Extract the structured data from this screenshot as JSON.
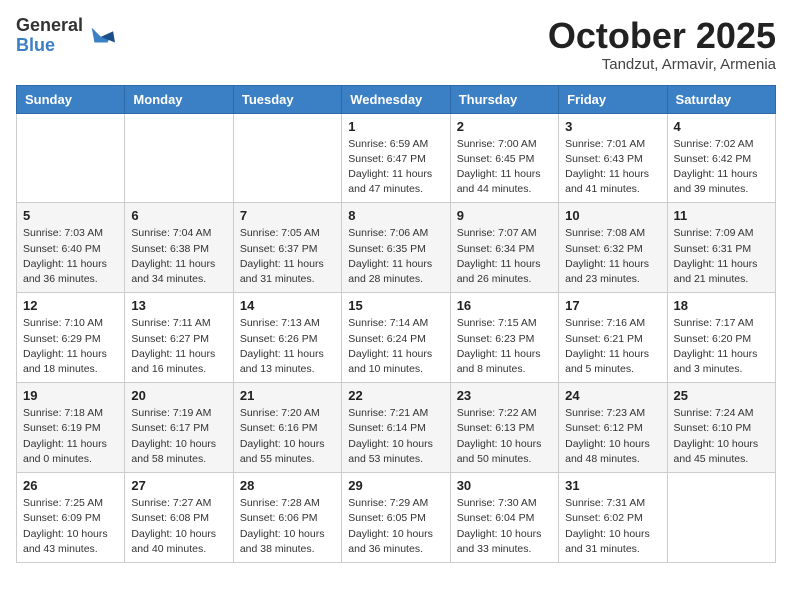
{
  "logo": {
    "general": "General",
    "blue": "Blue"
  },
  "title": "October 2025",
  "subtitle": "Tandzut, Armavir, Armenia",
  "days_of_week": [
    "Sunday",
    "Monday",
    "Tuesday",
    "Wednesday",
    "Thursday",
    "Friday",
    "Saturday"
  ],
  "weeks": [
    [
      {
        "day": "",
        "info": ""
      },
      {
        "day": "",
        "info": ""
      },
      {
        "day": "",
        "info": ""
      },
      {
        "day": "1",
        "info": "Sunrise: 6:59 AM\nSunset: 6:47 PM\nDaylight: 11 hours\nand 47 minutes."
      },
      {
        "day": "2",
        "info": "Sunrise: 7:00 AM\nSunset: 6:45 PM\nDaylight: 11 hours\nand 44 minutes."
      },
      {
        "day": "3",
        "info": "Sunrise: 7:01 AM\nSunset: 6:43 PM\nDaylight: 11 hours\nand 41 minutes."
      },
      {
        "day": "4",
        "info": "Sunrise: 7:02 AM\nSunset: 6:42 PM\nDaylight: 11 hours\nand 39 minutes."
      }
    ],
    [
      {
        "day": "5",
        "info": "Sunrise: 7:03 AM\nSunset: 6:40 PM\nDaylight: 11 hours\nand 36 minutes."
      },
      {
        "day": "6",
        "info": "Sunrise: 7:04 AM\nSunset: 6:38 PM\nDaylight: 11 hours\nand 34 minutes."
      },
      {
        "day": "7",
        "info": "Sunrise: 7:05 AM\nSunset: 6:37 PM\nDaylight: 11 hours\nand 31 minutes."
      },
      {
        "day": "8",
        "info": "Sunrise: 7:06 AM\nSunset: 6:35 PM\nDaylight: 11 hours\nand 28 minutes."
      },
      {
        "day": "9",
        "info": "Sunrise: 7:07 AM\nSunset: 6:34 PM\nDaylight: 11 hours\nand 26 minutes."
      },
      {
        "day": "10",
        "info": "Sunrise: 7:08 AM\nSunset: 6:32 PM\nDaylight: 11 hours\nand 23 minutes."
      },
      {
        "day": "11",
        "info": "Sunrise: 7:09 AM\nSunset: 6:31 PM\nDaylight: 11 hours\nand 21 minutes."
      }
    ],
    [
      {
        "day": "12",
        "info": "Sunrise: 7:10 AM\nSunset: 6:29 PM\nDaylight: 11 hours\nand 18 minutes."
      },
      {
        "day": "13",
        "info": "Sunrise: 7:11 AM\nSunset: 6:27 PM\nDaylight: 11 hours\nand 16 minutes."
      },
      {
        "day": "14",
        "info": "Sunrise: 7:13 AM\nSunset: 6:26 PM\nDaylight: 11 hours\nand 13 minutes."
      },
      {
        "day": "15",
        "info": "Sunrise: 7:14 AM\nSunset: 6:24 PM\nDaylight: 11 hours\nand 10 minutes."
      },
      {
        "day": "16",
        "info": "Sunrise: 7:15 AM\nSunset: 6:23 PM\nDaylight: 11 hours\nand 8 minutes."
      },
      {
        "day": "17",
        "info": "Sunrise: 7:16 AM\nSunset: 6:21 PM\nDaylight: 11 hours\nand 5 minutes."
      },
      {
        "day": "18",
        "info": "Sunrise: 7:17 AM\nSunset: 6:20 PM\nDaylight: 11 hours\nand 3 minutes."
      }
    ],
    [
      {
        "day": "19",
        "info": "Sunrise: 7:18 AM\nSunset: 6:19 PM\nDaylight: 11 hours\nand 0 minutes."
      },
      {
        "day": "20",
        "info": "Sunrise: 7:19 AM\nSunset: 6:17 PM\nDaylight: 10 hours\nand 58 minutes."
      },
      {
        "day": "21",
        "info": "Sunrise: 7:20 AM\nSunset: 6:16 PM\nDaylight: 10 hours\nand 55 minutes."
      },
      {
        "day": "22",
        "info": "Sunrise: 7:21 AM\nSunset: 6:14 PM\nDaylight: 10 hours\nand 53 minutes."
      },
      {
        "day": "23",
        "info": "Sunrise: 7:22 AM\nSunset: 6:13 PM\nDaylight: 10 hours\nand 50 minutes."
      },
      {
        "day": "24",
        "info": "Sunrise: 7:23 AM\nSunset: 6:12 PM\nDaylight: 10 hours\nand 48 minutes."
      },
      {
        "day": "25",
        "info": "Sunrise: 7:24 AM\nSunset: 6:10 PM\nDaylight: 10 hours\nand 45 minutes."
      }
    ],
    [
      {
        "day": "26",
        "info": "Sunrise: 7:25 AM\nSunset: 6:09 PM\nDaylight: 10 hours\nand 43 minutes."
      },
      {
        "day": "27",
        "info": "Sunrise: 7:27 AM\nSunset: 6:08 PM\nDaylight: 10 hours\nand 40 minutes."
      },
      {
        "day": "28",
        "info": "Sunrise: 7:28 AM\nSunset: 6:06 PM\nDaylight: 10 hours\nand 38 minutes."
      },
      {
        "day": "29",
        "info": "Sunrise: 7:29 AM\nSunset: 6:05 PM\nDaylight: 10 hours\nand 36 minutes."
      },
      {
        "day": "30",
        "info": "Sunrise: 7:30 AM\nSunset: 6:04 PM\nDaylight: 10 hours\nand 33 minutes."
      },
      {
        "day": "31",
        "info": "Sunrise: 7:31 AM\nSunset: 6:02 PM\nDaylight: 10 hours\nand 31 minutes."
      },
      {
        "day": "",
        "info": ""
      }
    ]
  ]
}
